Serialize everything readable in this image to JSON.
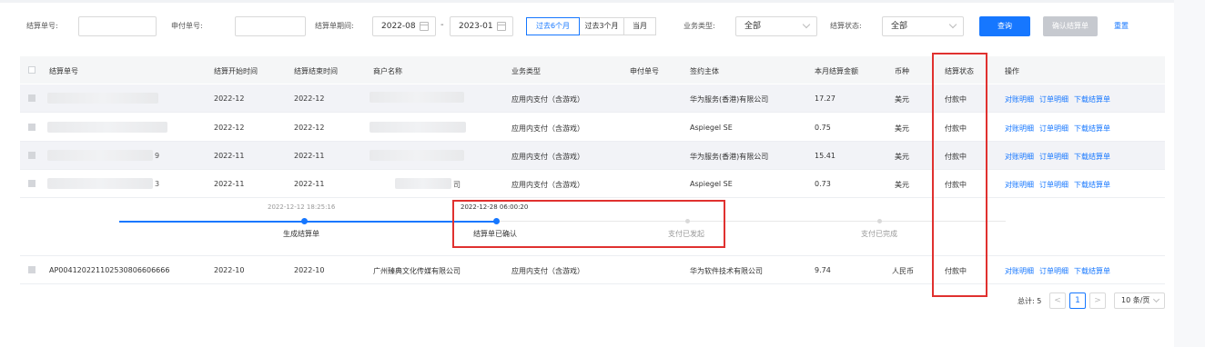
{
  "filters": {
    "settlement_no_label": "结算单号:",
    "payment_no_label": "申付单号:",
    "period_label": "结算单期间:",
    "period_start": "2022-08",
    "period_sep": "-",
    "period_end": "2023-01",
    "range_buttons": [
      "过去6个月",
      "过去3个月",
      "当月"
    ],
    "business_type_label": "业务类型:",
    "business_type_value": "全部",
    "status_label": "结算状态:",
    "status_value": "全部",
    "query_button": "查询",
    "confirm_button": "确认结算单",
    "reset_link": "重置"
  },
  "table": {
    "headers": [
      "结算单号",
      "结算开始时间",
      "结算结束时间",
      "商户名称",
      "业务类型",
      "申付单号",
      "签约主体",
      "本月结算金额",
      "币种",
      "结算状态",
      "操作"
    ],
    "rows": [
      {
        "settlement_no_suffix": "",
        "start": "2022-12",
        "end": "2022-12",
        "merchant_suffix": "",
        "business": "应用内支付（含游戏）",
        "payment_no": "",
        "entity": "华为服务(香港)有限公司",
        "amount": "17.27",
        "currency": "美元",
        "status": "付款中"
      },
      {
        "settlement_no_suffix": "",
        "start": "2022-12",
        "end": "2022-12",
        "merchant_suffix": "",
        "business": "应用内支付（含游戏）",
        "payment_no": "",
        "entity": "Aspiegel SE",
        "amount": "0.75",
        "currency": "美元",
        "status": "付款中"
      },
      {
        "settlement_no_suffix": "9",
        "start": "2022-11",
        "end": "2022-11",
        "merchant_suffix": "",
        "business": "应用内支付（含游戏）",
        "payment_no": "",
        "entity": "华为服务(香港)有限公司",
        "amount": "15.41",
        "currency": "美元",
        "status": "付款中"
      },
      {
        "settlement_no_suffix": "3",
        "start": "2022-11",
        "end": "2022-11",
        "merchant_suffix": "司",
        "business": "应用内支付（含游戏）",
        "payment_no": "",
        "entity": "Aspiegel SE",
        "amount": "0.73",
        "currency": "美元",
        "status": "付款中"
      }
    ],
    "last_row": {
      "settlement_no": "AP004120221102530806606666",
      "start": "2022-10",
      "end": "2022-10",
      "merchant": "广州臻典文化传媒有限公司",
      "business": "应用内支付（含游戏）",
      "payment_no": "",
      "entity": "华为软件技术有限公司",
      "amount": "9.74",
      "currency": "人民币",
      "status": "付款中"
    },
    "ops": [
      "对账明细",
      "订单明细",
      "下载结算单"
    ]
  },
  "timeline": {
    "steps": [
      {
        "time": "2022-12-12 18:25:16",
        "label": "生成结算单"
      },
      {
        "time": "2022-12-28 06:00:20",
        "label": "结算单已确认"
      },
      {
        "time": "",
        "label": "支付已发起"
      },
      {
        "time": "",
        "label": "支付已完成"
      }
    ]
  },
  "pagination": {
    "total_label": "总计: 5",
    "prev": "<",
    "current": "1",
    "next": ">",
    "page_size": "10 条/页"
  },
  "colors": {
    "accent": "#1677ff",
    "highlight_box": "#e0312f"
  }
}
